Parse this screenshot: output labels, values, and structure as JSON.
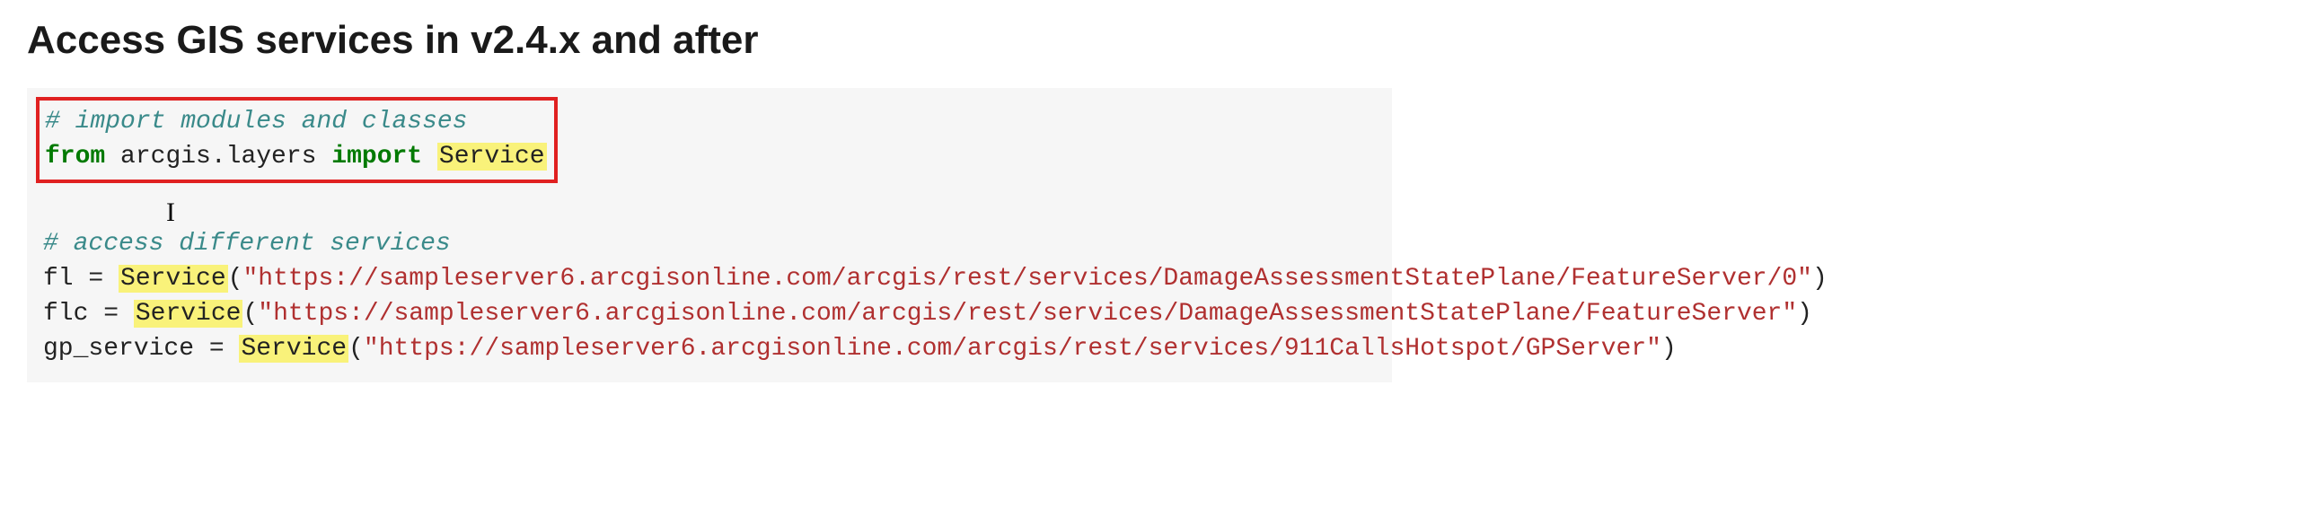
{
  "heading": "Access GIS services in v2.4.x and after",
  "code": {
    "comment1": "# import modules and classes",
    "kw_from": "from",
    "module": "arcgis.layers",
    "kw_import": "import",
    "cls": "Service",
    "comment2": "# access different services",
    "line1": {
      "var": "fl",
      "eq": " = ",
      "call": "Service",
      "open": "(",
      "str": "\"https://sampleserver6.arcgisonline.com/arcgis/rest/services/DamageAssessmentStatePlane/FeatureServer/0\"",
      "close": ")"
    },
    "line2": {
      "var": "flc",
      "eq": " = ",
      "call": "Service",
      "open": "(",
      "str": "\"https://sampleserver6.arcgisonline.com/arcgis/rest/services/DamageAssessmentStatePlane/FeatureServer\"",
      "close": ")"
    },
    "line3": {
      "var": "gp_service",
      "eq": " = ",
      "call": "Service",
      "open": "(",
      "str": "\"https://sampleserver6.arcgisonline.com/arcgis/rest/services/911CallsHotspot/GPServer\"",
      "close": ")"
    }
  }
}
